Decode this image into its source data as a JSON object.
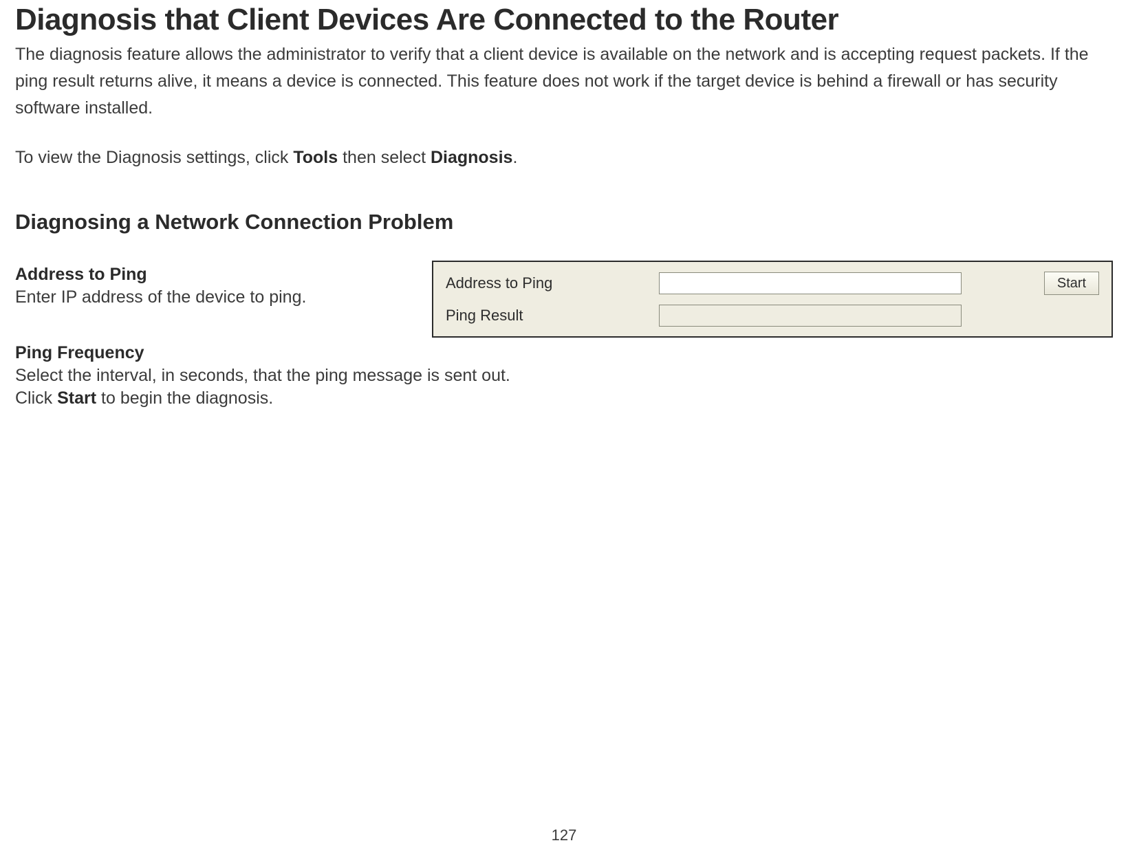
{
  "page": {
    "title": "Diagnosis that Client Devices Are Connected to the Router",
    "intro": "The diagnosis feature allows the administrator to verify that a client device is available on the network and is accepting request packets. If the ping result returns alive, it means a device is connected. This feature does not work if the target device is behind a firewall or has security software installed.",
    "nav_prefix": "To view the Diagnosis settings, click ",
    "nav_bold1": "Tools",
    "nav_mid": " then select ",
    "nav_bold2": "Diagnosis",
    "nav_suffix": ".",
    "subtitle": "Diagnosing a Network Connection Problem",
    "number": "127"
  },
  "fields": {
    "address_title": "Address to Ping",
    "address_desc": "Enter IP address of the device to ping.",
    "freq_title": "Ping Frequency",
    "freq_desc": "Select the interval, in seconds, that the ping message is sent out.",
    "start_prefix": "Click ",
    "start_bold": "Start",
    "start_suffix": " to begin the diagnosis."
  },
  "panel": {
    "address_label": "Address to Ping",
    "address_value": "",
    "result_label": "Ping Result",
    "result_value": "",
    "start_button": "Start"
  }
}
